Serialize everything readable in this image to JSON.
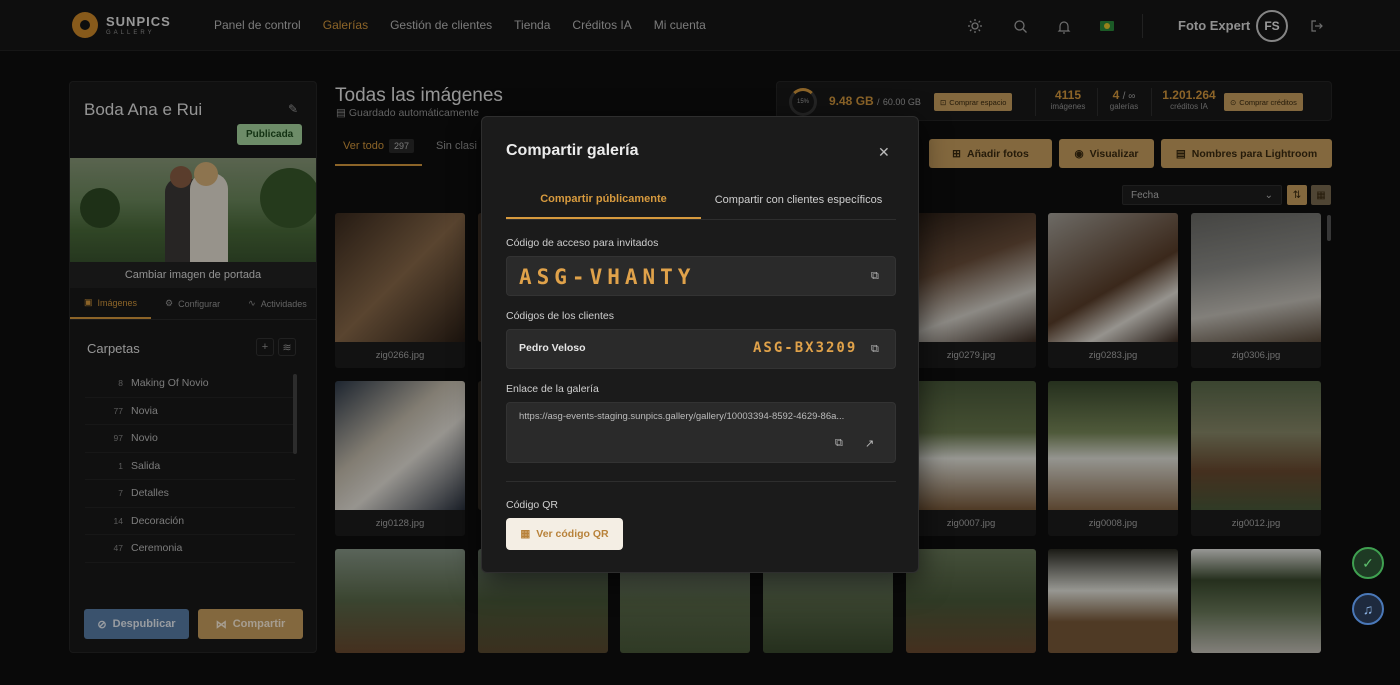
{
  "app": {
    "logo_name": "SUNPICS",
    "logo_sub": "GALLERY"
  },
  "nav": {
    "items": [
      "Panel de control",
      "Galerías",
      "Gestión de clientes",
      "Tienda",
      "Créditos IA",
      "Mi cuenta"
    ],
    "active_index": 1
  },
  "header_icons": [
    "sun-icon",
    "search-icon",
    "bell-icon",
    "brazil-flag-icon"
  ],
  "user": {
    "name": "Foto Expert",
    "initials": "FS"
  },
  "gallery": {
    "title": "Boda Ana e Rui",
    "status": "Publicada",
    "change_cover": "Cambiar imagen de portada",
    "tabs": [
      "Imágenes",
      "Configurar",
      "Actividades"
    ],
    "folders_title": "Carpetas",
    "folders": [
      {
        "count": "8",
        "name": "Making Of Novio"
      },
      {
        "count": "77",
        "name": "Novia"
      },
      {
        "count": "97",
        "name": "Novio"
      },
      {
        "count": "1",
        "name": "Salida"
      },
      {
        "count": "7",
        "name": "Detalles"
      },
      {
        "count": "14",
        "name": "Decoración"
      },
      {
        "count": "47",
        "name": "Ceremonia"
      }
    ],
    "unpublish": "Despublicar",
    "share": "Compartir"
  },
  "main": {
    "title": "Todas las imágenes",
    "autosave": "Guardado automáticamente",
    "tab_all": "Ver todo",
    "tab_all_count": "297",
    "tab_unclassified": "Sin clasi",
    "add_photos": "Añadir fotos",
    "view": "Visualizar",
    "lightroom": "Nombres para Lightroom",
    "sort": "Fecha"
  },
  "stats": {
    "percent": "15%",
    "used": "9.48 GB",
    "separator": "/",
    "total": "60.00 GB",
    "buy_space": "Comprar espacio",
    "images_value": "4115",
    "images_label": "imágenes",
    "galleries_value": "4",
    "galleries_suffix": "/ ∞",
    "galleries_label": "galerías",
    "credits_value": "1.201.264",
    "credits_label": "créditos IA",
    "buy_credits": "Comprar créditos"
  },
  "thumbnails": {
    "row1": [
      "zig0266.jpg",
      "zig0279.jpg",
      "zig0283.jpg",
      "zig0306.jpg"
    ],
    "row2": [
      "zig0128.jpg",
      "zig0007.jpg",
      "zig0008.jpg",
      "zig0012.jpg"
    ]
  },
  "modal": {
    "title": "Compartir galería",
    "tab_public": "Compartir públicamente",
    "tab_clients": "Compartir con clientes específicos",
    "guest_code_label": "Código de acceso para invitados",
    "guest_code": "ASG-VHANTY",
    "client_codes_label": "Códigos de los clientes",
    "client_name": "Pedro Veloso",
    "client_code": "ASG-BX3209",
    "link_label": "Enlace de la galería",
    "link": "https://asg-events-staging.sunpics.gallery/gallery/10003394-8592-4629-86a...",
    "qr_label": "Código QR",
    "qr_button": "Ver código QR"
  },
  "colors": {
    "accent": "#d79a3e",
    "published": "#a8d8a0",
    "unpublish": "#5a7fa8"
  }
}
